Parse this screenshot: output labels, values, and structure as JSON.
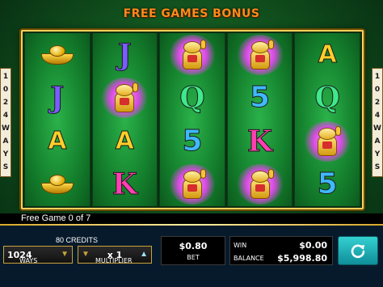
{
  "header": {
    "title": "FREE GAMES BONUS"
  },
  "side_panels": {
    "digits": [
      "1",
      "0",
      "2",
      "4"
    ],
    "word": [
      "W",
      "A",
      "Y",
      "S"
    ]
  },
  "reels": [
    [
      "ingot",
      "J",
      "A",
      "ingot"
    ],
    [
      "J",
      "cat",
      "A",
      "K"
    ],
    [
      "cat",
      "Q",
      "5",
      "cat"
    ],
    [
      "cat",
      "5",
      "K",
      "cat"
    ],
    [
      "A",
      "Q",
      "cat",
      "5"
    ]
  ],
  "status": {
    "free_game": "Free Game 0 of 7"
  },
  "credits": {
    "label": "80 CREDITS"
  },
  "ways": {
    "value": "1024",
    "label": "WAYS"
  },
  "multiplier": {
    "value": "x 1",
    "label": "MULTIPLIER"
  },
  "bet": {
    "value": "$0.80",
    "label": "BET"
  },
  "win": {
    "label": "WIN",
    "value": "$0.00"
  },
  "balance": {
    "label": "BALANCE",
    "value": "$5,998.80"
  },
  "colors": {
    "title": "#ff8a1c",
    "frame_gold": "#ffd15a",
    "spin": "#1fb8c0"
  },
  "icons": {
    "spin": "refresh-icon",
    "decrease": "triangle-down-icon",
    "increase": "triangle-up-icon"
  }
}
